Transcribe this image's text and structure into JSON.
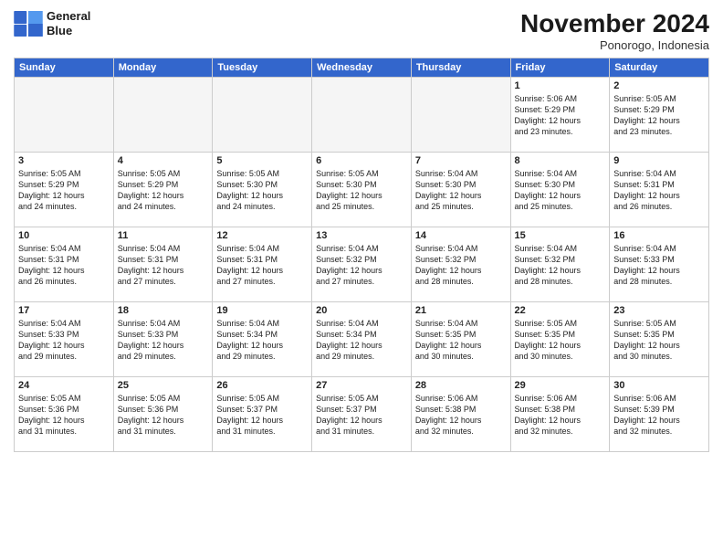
{
  "logo": {
    "line1": "General",
    "line2": "Blue"
  },
  "title": "November 2024",
  "location": "Ponorogo, Indonesia",
  "headers": [
    "Sunday",
    "Monday",
    "Tuesday",
    "Wednesday",
    "Thursday",
    "Friday",
    "Saturday"
  ],
  "weeks": [
    [
      {
        "day": "",
        "info": "",
        "empty": true
      },
      {
        "day": "",
        "info": "",
        "empty": true
      },
      {
        "day": "",
        "info": "",
        "empty": true
      },
      {
        "day": "",
        "info": "",
        "empty": true
      },
      {
        "day": "",
        "info": "",
        "empty": true
      },
      {
        "day": "1",
        "info": "Sunrise: 5:06 AM\nSunset: 5:29 PM\nDaylight: 12 hours\nand 23 minutes."
      },
      {
        "day": "2",
        "info": "Sunrise: 5:05 AM\nSunset: 5:29 PM\nDaylight: 12 hours\nand 23 minutes."
      }
    ],
    [
      {
        "day": "3",
        "info": "Sunrise: 5:05 AM\nSunset: 5:29 PM\nDaylight: 12 hours\nand 24 minutes."
      },
      {
        "day": "4",
        "info": "Sunrise: 5:05 AM\nSunset: 5:29 PM\nDaylight: 12 hours\nand 24 minutes."
      },
      {
        "day": "5",
        "info": "Sunrise: 5:05 AM\nSunset: 5:30 PM\nDaylight: 12 hours\nand 24 minutes."
      },
      {
        "day": "6",
        "info": "Sunrise: 5:05 AM\nSunset: 5:30 PM\nDaylight: 12 hours\nand 25 minutes."
      },
      {
        "day": "7",
        "info": "Sunrise: 5:04 AM\nSunset: 5:30 PM\nDaylight: 12 hours\nand 25 minutes."
      },
      {
        "day": "8",
        "info": "Sunrise: 5:04 AM\nSunset: 5:30 PM\nDaylight: 12 hours\nand 25 minutes."
      },
      {
        "day": "9",
        "info": "Sunrise: 5:04 AM\nSunset: 5:31 PM\nDaylight: 12 hours\nand 26 minutes."
      }
    ],
    [
      {
        "day": "10",
        "info": "Sunrise: 5:04 AM\nSunset: 5:31 PM\nDaylight: 12 hours\nand 26 minutes."
      },
      {
        "day": "11",
        "info": "Sunrise: 5:04 AM\nSunset: 5:31 PM\nDaylight: 12 hours\nand 27 minutes."
      },
      {
        "day": "12",
        "info": "Sunrise: 5:04 AM\nSunset: 5:31 PM\nDaylight: 12 hours\nand 27 minutes."
      },
      {
        "day": "13",
        "info": "Sunrise: 5:04 AM\nSunset: 5:32 PM\nDaylight: 12 hours\nand 27 minutes."
      },
      {
        "day": "14",
        "info": "Sunrise: 5:04 AM\nSunset: 5:32 PM\nDaylight: 12 hours\nand 28 minutes."
      },
      {
        "day": "15",
        "info": "Sunrise: 5:04 AM\nSunset: 5:32 PM\nDaylight: 12 hours\nand 28 minutes."
      },
      {
        "day": "16",
        "info": "Sunrise: 5:04 AM\nSunset: 5:33 PM\nDaylight: 12 hours\nand 28 minutes."
      }
    ],
    [
      {
        "day": "17",
        "info": "Sunrise: 5:04 AM\nSunset: 5:33 PM\nDaylight: 12 hours\nand 29 minutes."
      },
      {
        "day": "18",
        "info": "Sunrise: 5:04 AM\nSunset: 5:33 PM\nDaylight: 12 hours\nand 29 minutes."
      },
      {
        "day": "19",
        "info": "Sunrise: 5:04 AM\nSunset: 5:34 PM\nDaylight: 12 hours\nand 29 minutes."
      },
      {
        "day": "20",
        "info": "Sunrise: 5:04 AM\nSunset: 5:34 PM\nDaylight: 12 hours\nand 29 minutes."
      },
      {
        "day": "21",
        "info": "Sunrise: 5:04 AM\nSunset: 5:35 PM\nDaylight: 12 hours\nand 30 minutes."
      },
      {
        "day": "22",
        "info": "Sunrise: 5:05 AM\nSunset: 5:35 PM\nDaylight: 12 hours\nand 30 minutes."
      },
      {
        "day": "23",
        "info": "Sunrise: 5:05 AM\nSunset: 5:35 PM\nDaylight: 12 hours\nand 30 minutes."
      }
    ],
    [
      {
        "day": "24",
        "info": "Sunrise: 5:05 AM\nSunset: 5:36 PM\nDaylight: 12 hours\nand 31 minutes."
      },
      {
        "day": "25",
        "info": "Sunrise: 5:05 AM\nSunset: 5:36 PM\nDaylight: 12 hours\nand 31 minutes."
      },
      {
        "day": "26",
        "info": "Sunrise: 5:05 AM\nSunset: 5:37 PM\nDaylight: 12 hours\nand 31 minutes."
      },
      {
        "day": "27",
        "info": "Sunrise: 5:05 AM\nSunset: 5:37 PM\nDaylight: 12 hours\nand 31 minutes."
      },
      {
        "day": "28",
        "info": "Sunrise: 5:06 AM\nSunset: 5:38 PM\nDaylight: 12 hours\nand 32 minutes."
      },
      {
        "day": "29",
        "info": "Sunrise: 5:06 AM\nSunset: 5:38 PM\nDaylight: 12 hours\nand 32 minutes."
      },
      {
        "day": "30",
        "info": "Sunrise: 5:06 AM\nSunset: 5:39 PM\nDaylight: 12 hours\nand 32 minutes."
      }
    ]
  ]
}
